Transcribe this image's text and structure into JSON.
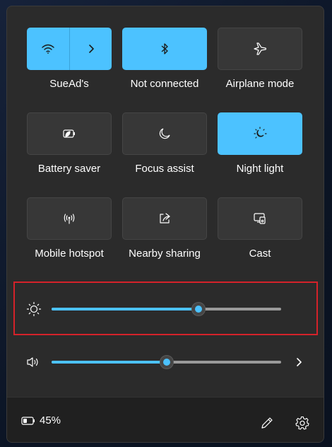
{
  "tiles": [
    {
      "label": "SueAd's",
      "icon": "wifi-icon",
      "secondary_icon": "chevron-right-icon",
      "active": true
    },
    {
      "label": "Not connected",
      "icon": "bluetooth-icon",
      "active": true
    },
    {
      "label": "Airplane mode",
      "icon": "airplane-icon",
      "active": false
    },
    {
      "label": "Battery saver",
      "icon": "battery-saver-icon",
      "active": false
    },
    {
      "label": "Focus assist",
      "icon": "moon-icon",
      "active": false
    },
    {
      "label": "Night light",
      "icon": "night-light-icon",
      "active": true
    },
    {
      "label": "Mobile hotspot",
      "icon": "hotspot-icon",
      "active": false
    },
    {
      "label": "Nearby sharing",
      "icon": "share-icon",
      "active": false
    },
    {
      "label": "Cast",
      "icon": "cast-icon",
      "active": false
    }
  ],
  "sliders": {
    "brightness": {
      "icon": "brightness-icon",
      "level": 0.64,
      "highlighted": true
    },
    "volume": {
      "icon": "speaker-icon",
      "level": 0.5,
      "expand_icon": "chevron-right-icon"
    }
  },
  "footer": {
    "battery_icon": "battery-icon",
    "battery_text": "45%",
    "edit_icon": "pencil-icon",
    "settings_icon": "gear-icon"
  },
  "colors": {
    "accent": "#4cc2ff",
    "panel": "#2b2b2b",
    "tile_off": "#373737",
    "footer": "#202020",
    "highlight": "#d4222a"
  }
}
